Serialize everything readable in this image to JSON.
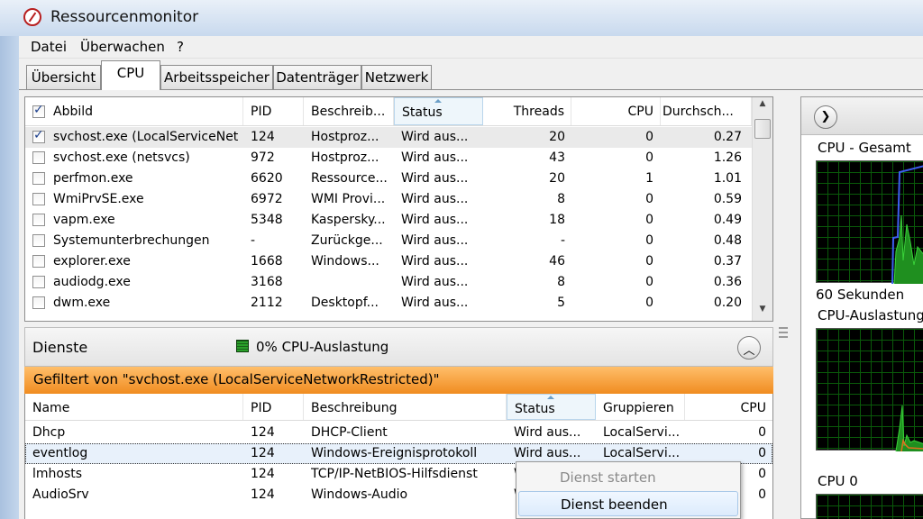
{
  "window": {
    "title": "Ressourcenmonitor"
  },
  "menu": [
    "Datei",
    "Überwachen",
    "?"
  ],
  "tabs": [
    {
      "label": "Übersicht",
      "active": false
    },
    {
      "label": "CPU",
      "active": true
    },
    {
      "label": "Arbeitsspeicher",
      "active": false
    },
    {
      "label": "Datenträger",
      "active": false
    },
    {
      "label": "Netzwerk",
      "active": false
    }
  ],
  "processes": {
    "headers": {
      "image": "Abbild",
      "pid": "PID",
      "desc": "Beschreib...",
      "status": "Status",
      "threads": "Threads",
      "cpu": "CPU",
      "avg": "Durchsch..."
    },
    "header_checked": true,
    "rows": [
      {
        "checked": true,
        "image": "svchost.exe (LocalServiceNet...",
        "pid": "124",
        "desc": "Hostproz...",
        "status": "Wird aus...",
        "threads": "20",
        "cpu": "0",
        "avg": "0.27"
      },
      {
        "checked": false,
        "image": "svchost.exe (netsvcs)",
        "pid": "972",
        "desc": "Hostproz...",
        "status": "Wird aus...",
        "threads": "43",
        "cpu": "0",
        "avg": "1.26"
      },
      {
        "checked": false,
        "image": "perfmon.exe",
        "pid": "6620",
        "desc": "Ressource...",
        "status": "Wird aus...",
        "threads": "20",
        "cpu": "1",
        "avg": "1.01"
      },
      {
        "checked": false,
        "image": "WmiPrvSE.exe",
        "pid": "6972",
        "desc": "WMI Provi...",
        "status": "Wird aus...",
        "threads": "8",
        "cpu": "0",
        "avg": "0.59"
      },
      {
        "checked": false,
        "image": "vapm.exe",
        "pid": "5348",
        "desc": "Kaspersky...",
        "status": "Wird aus...",
        "threads": "18",
        "cpu": "0",
        "avg": "0.49"
      },
      {
        "checked": false,
        "image": "Systemunterbrechungen",
        "pid": "-",
        "desc": "Zurückge...",
        "status": "Wird aus...",
        "threads": "-",
        "cpu": "0",
        "avg": "0.48"
      },
      {
        "checked": false,
        "image": "explorer.exe",
        "pid": "1668",
        "desc": "Windows...",
        "status": "Wird aus...",
        "threads": "46",
        "cpu": "0",
        "avg": "0.37"
      },
      {
        "checked": false,
        "image": "audiodg.exe",
        "pid": "3168",
        "desc": "",
        "status": "Wird aus...",
        "threads": "8",
        "cpu": "0",
        "avg": "0.36"
      },
      {
        "checked": false,
        "image": "dwm.exe",
        "pid": "2112",
        "desc": "Desktopf...",
        "status": "Wird aus...",
        "threads": "5",
        "cpu": "0",
        "avg": "0.20"
      }
    ]
  },
  "services": {
    "title": "Dienste",
    "cpu_label": "0% CPU-Auslastung",
    "filter_text": "Gefiltert von \"svchost.exe (LocalServiceNetworkRestricted)\"",
    "headers": {
      "name": "Name",
      "pid": "PID",
      "desc": "Beschreibung",
      "status": "Status",
      "group": "Gruppieren",
      "cpu": "CPU"
    },
    "rows": [
      {
        "name": "Dhcp",
        "pid": "124",
        "desc": "DHCP-Client",
        "status": "Wird aus...",
        "group": "LocalServi...",
        "cpu": "0"
      },
      {
        "name": "eventlog",
        "pid": "124",
        "desc": "Windows-Ereignisprotokoll",
        "status": "Wird aus...",
        "group": "LocalServi...",
        "cpu": "0"
      },
      {
        "name": "lmhosts",
        "pid": "124",
        "desc": "TCP/IP-NetBIOS-Hilfsdienst",
        "status": "W",
        "group": "",
        "cpu": "0"
      },
      {
        "name": "AudioSrv",
        "pid": "124",
        "desc": "Windows-Audio",
        "status": "W",
        "group": "",
        "cpu": "0"
      }
    ]
  },
  "context_menu": {
    "start": "Dienst starten",
    "stop": "Dienst beenden"
  },
  "graphs": {
    "total_label": "CPU - Gesamt",
    "seconds_label": "60 Sekunden",
    "usage_label": "CPU-Auslastung",
    "cpu0_label": "CPU 0"
  },
  "colors": {
    "accent_blue": "#2f4fd8",
    "graph_green": "#2fc02f",
    "filter_orange": "#f08c20"
  }
}
